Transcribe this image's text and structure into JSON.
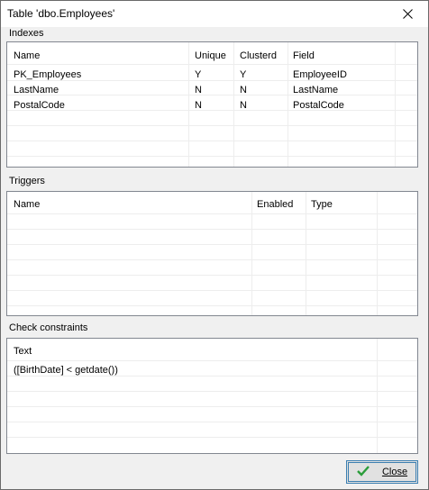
{
  "window": {
    "title": "Table 'dbo.Employees'"
  },
  "indexes": {
    "label": "Indexes",
    "columns": [
      "Name",
      "Unique",
      "Clusterd",
      "Field"
    ],
    "rows": [
      [
        "PK_Employees",
        "Y",
        "Y",
        "EmployeeID"
      ],
      [
        "LastName",
        "N",
        "N",
        "LastName"
      ],
      [
        "PostalCode",
        "N",
        "N",
        "PostalCode"
      ]
    ]
  },
  "triggers": {
    "label": "Triggers",
    "columns": [
      "Name",
      "Enabled",
      "Type"
    ],
    "rows": []
  },
  "check_constraints": {
    "label": "Check constraints",
    "columns": [
      "Text"
    ],
    "rows": [
      [
        "([BirthDate] < getdate())"
      ]
    ]
  },
  "close_button": {
    "label": "Close"
  },
  "colors": {
    "border": "#828790",
    "accent": "#3c7fb1",
    "check": "#2a9d3a"
  }
}
